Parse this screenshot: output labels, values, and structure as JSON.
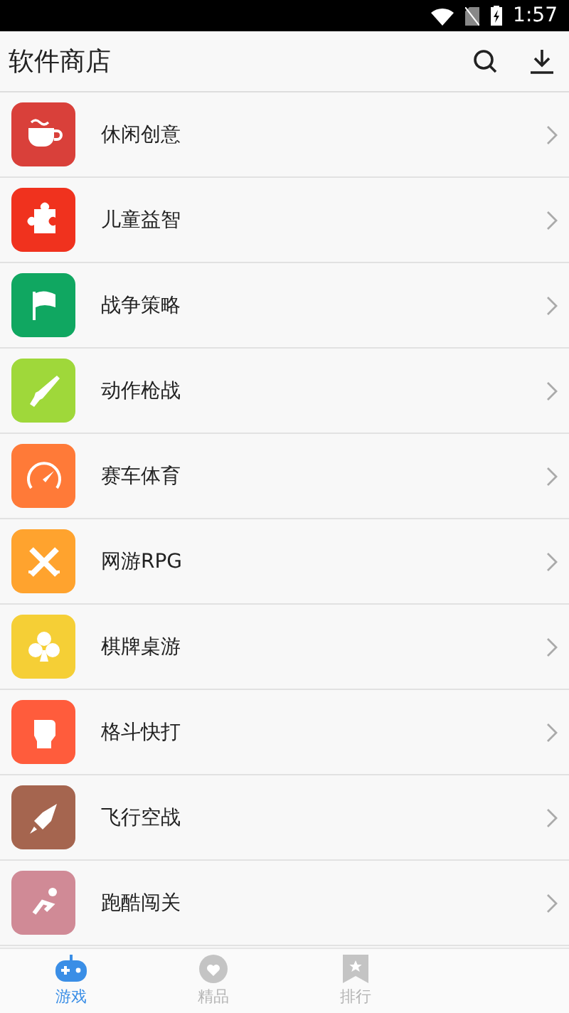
{
  "status_bar": {
    "time": "1:57"
  },
  "app_bar": {
    "title": "软件商店"
  },
  "categories": [
    {
      "label": "休闲创意",
      "color": "#d9403a"
    },
    {
      "label": "儿童益智",
      "color": "#f0321e"
    },
    {
      "label": "战争策略",
      "color": "#10a761"
    },
    {
      "label": "动作枪战",
      "color": "#9fd83a"
    },
    {
      "label": "赛车体育",
      "color": "#ff7a38"
    },
    {
      "label": "网游RPG",
      "color": "#ffa32e"
    },
    {
      "label": "棋牌桌游",
      "color": "#f5cf36"
    },
    {
      "label": "格斗快打",
      "color": "#ff5c3c"
    },
    {
      "label": "飞行空战",
      "color": "#a5654f"
    },
    {
      "label": "跑酷闯关",
      "color": "#d08a96"
    }
  ],
  "tabs": [
    {
      "label": "游戏",
      "selected": true
    },
    {
      "label": "精品",
      "selected": false
    },
    {
      "label": "排行",
      "selected": false
    }
  ]
}
